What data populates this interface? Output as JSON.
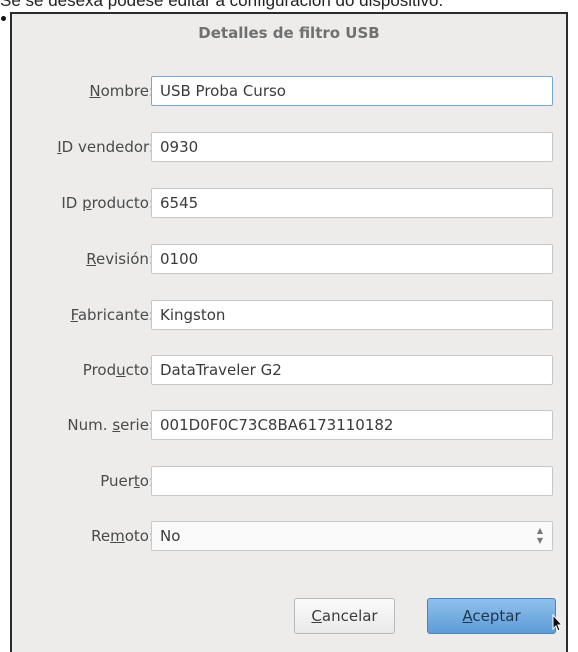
{
  "caption": "Se se desexa podese editar a configuración do dispositivo.",
  "dialog": {
    "title": "Detalles de filtro USB",
    "fields": [
      {
        "label": "Nombre:",
        "mnemonic": "N",
        "rest": "ombre:",
        "value": "USB Proba Curso"
      },
      {
        "label": "ID vendedor:",
        "mnemonic": "I",
        "rest": "D vendedor:",
        "value": "0930"
      },
      {
        "label": "ID producto:",
        "pre": "ID ",
        "mnemonic": "p",
        "rest": "roducto:",
        "value": "6545"
      },
      {
        "label": "Revisión:",
        "mnemonic": "R",
        "rest": "evisión:",
        "value": "0100"
      },
      {
        "label": "Fabricante:",
        "mnemonic": "F",
        "rest": "abricante:",
        "value": "Kingston"
      },
      {
        "label": "Producto:",
        "pre": "Prod",
        "mnemonic": "u",
        "rest": "cto:",
        "value": "DataTraveler G2"
      },
      {
        "label": "Num. serie:",
        "pre": "Num. ",
        "mnemonic": "s",
        "rest": "erie:",
        "value": "001D0F0C73C8BA6173110182"
      },
      {
        "label": "Puerto:",
        "pre": "Puer",
        "mnemonic": "t",
        "rest": "o:",
        "value": ""
      }
    ],
    "remote": {
      "label": "Remoto:",
      "pre": "Re",
      "mnemonic": "m",
      "rest": "oto:",
      "value": "No"
    },
    "buttons": {
      "cancel": {
        "mnemonic": "C",
        "rest": "ancelar"
      },
      "ok": {
        "mnemonic": "A",
        "rest": "ceptar"
      }
    }
  }
}
